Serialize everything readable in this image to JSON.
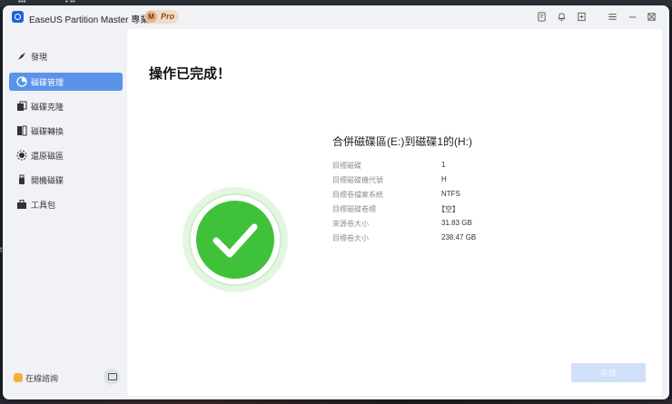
{
  "titlebar": {
    "app_name": "EaseUS Partition Master 專業版",
    "badge_letter": "M",
    "badge_text": "Pro",
    "icons": [
      "feedback-icon",
      "notification-icon",
      "login-icon",
      "settings-icon",
      "minimize-icon",
      "maximize-icon",
      "close-icon"
    ]
  },
  "sidebar": {
    "items": [
      {
        "label": "發現",
        "icon": "compass-icon"
      },
      {
        "label": "磁碟管理",
        "icon": "pie-chart-icon",
        "active": true
      },
      {
        "label": "磁碟克隆",
        "icon": "clone-icon"
      },
      {
        "label": "磁碟轉換",
        "icon": "convert-icon"
      },
      {
        "label": "還原磁區",
        "icon": "recovery-icon"
      },
      {
        "label": "開機磁碟",
        "icon": "usb-icon"
      },
      {
        "label": "工具包",
        "icon": "toolbox-icon"
      }
    ],
    "help_label": "在線諮詢"
  },
  "main": {
    "title": "操作已完成！",
    "operation_title": "合併磁碟區(E:)到磁碟1的(H:)",
    "details": [
      {
        "label": "目標磁碟",
        "value": "1"
      },
      {
        "label": "目標磁碟機代號",
        "value": "H"
      },
      {
        "label": "目標卷檔案系統",
        "value": "NTFS"
      },
      {
        "label": "目標磁碟卷標",
        "value": "【空】"
      },
      {
        "label": "來源卷大小",
        "value": "31.83 GB"
      },
      {
        "label": "目標卷大小",
        "value": "238.47 GB"
      }
    ],
    "finish_label": "完成"
  },
  "colors": {
    "accent": "#5a93e8",
    "success": "#3fc23a",
    "button_disabled": "#cfe0f8"
  }
}
